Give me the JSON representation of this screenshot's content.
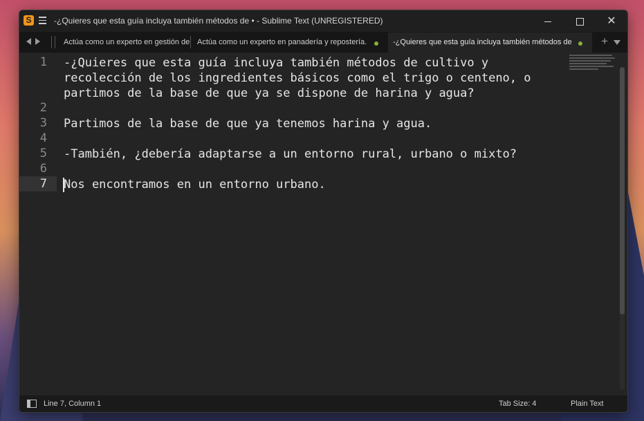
{
  "window": {
    "title": "-¿Quieres que esta guía incluya también métodos de • - Sublime Text (UNREGISTERED)",
    "app_icon": "S"
  },
  "tabs": [
    {
      "label": "Actúa como un experto en gestión de",
      "modified": false,
      "active": false
    },
    {
      "label": "Actúa como un experto en panadería y repostería.",
      "modified": true,
      "active": false
    },
    {
      "label": "-¿Quieres que esta guía incluya también métodos de",
      "modified": true,
      "active": true
    }
  ],
  "editor": {
    "line_numbers": [
      "1",
      "2",
      "3",
      "4",
      "5",
      "6",
      "7"
    ],
    "current_line": "7",
    "lines": [
      "-¿Quieres que esta guía incluya también métodos de cultivo y",
      "recolección de los ingredientes básicos como el trigo o centeno, o",
      "partimos de la base de que ya se dispone de harina y agua?",
      "",
      "Partimos de la base de que ya tenemos harina y agua.",
      "",
      "-También, ¿debería adaptarse a un entorno rural, urbano o mixto?",
      "",
      "Nos encontramos en un entorno urbano."
    ]
  },
  "status_bar": {
    "position": "Line 7, Column 1",
    "tab_size": "Tab Size: 4",
    "syntax": "Plain Text"
  },
  "colors": {
    "accent_modified_dot": "#8cae3a",
    "app_icon": "#f0951a",
    "editor_bg": "#242424"
  }
}
